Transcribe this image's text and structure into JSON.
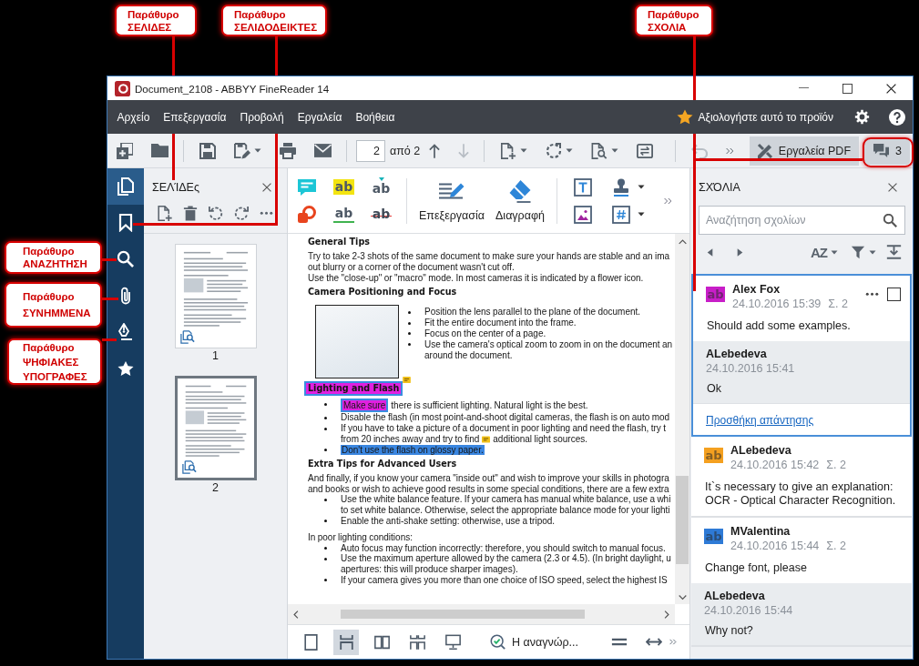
{
  "window": {
    "title": "Document_2108 - ABBYY FineReader 14"
  },
  "menu": {
    "items": [
      "Αρχείο",
      "Επεξεργασία",
      "Προβολή",
      "Εργαλεία",
      "Βοήθεια"
    ],
    "rate_label": "Αξιολογήστε αυτό το προϊόν"
  },
  "toolbar": {
    "groups": [
      [
        {
          "kind": "new-document",
          "dropdown": false,
          "disabled": false
        },
        {
          "kind": "open",
          "dropdown": false,
          "disabled": false
        }
      ],
      [
        {
          "kind": "save",
          "dropdown": false,
          "disabled": false
        },
        {
          "kind": "save-as",
          "dropdown": true,
          "disabled": false
        },
        {
          "kind": "print",
          "dropdown": false,
          "disabled": false
        },
        {
          "kind": "email",
          "dropdown": false,
          "disabled": false
        }
      ],
      [
        {
          "kind": "page-field",
          "value": "2",
          "suffix": "από 2"
        },
        {
          "kind": "previous-page",
          "dropdown": false,
          "disabled": false
        },
        {
          "kind": "next-page",
          "dropdown": false,
          "disabled": true
        }
      ],
      [
        {
          "kind": "add-page",
          "dropdown": true,
          "disabled": false
        },
        {
          "kind": "rotate",
          "dropdown": true,
          "disabled": false
        },
        {
          "kind": "recognize",
          "dropdown": true,
          "disabled": false
        },
        {
          "kind": "compare",
          "dropdown": false,
          "disabled": false
        }
      ],
      [
        {
          "kind": "undo",
          "dropdown": false,
          "disabled": true
        },
        {
          "kind": "more",
          "dropdown": false,
          "disabled": false
        }
      ]
    ],
    "pdf_tools": {
      "label": "Εργαλεία PDF",
      "selected": true
    },
    "comments_button": {
      "count": "3",
      "selected": true
    }
  },
  "sidebar": {
    "items": [
      {
        "kind": "pages",
        "selected": true
      },
      {
        "kind": "bookmarks",
        "selected": false
      },
      {
        "kind": "search",
        "selected": false
      },
      {
        "kind": "attachments",
        "selected": false
      },
      {
        "kind": "signatures",
        "selected": false
      },
      {
        "kind": "favorites",
        "selected": false
      }
    ]
  },
  "pages_panel": {
    "title": "ΣΕΛΊΔΕς",
    "tools": [
      {
        "kind": "add-page"
      },
      {
        "kind": "delete"
      },
      {
        "kind": "rotate-left"
      },
      {
        "kind": "rotate-right"
      },
      {
        "kind": "more"
      }
    ],
    "pages": [
      {
        "label": "1",
        "selected": false
      },
      {
        "label": "2",
        "selected": true
      }
    ]
  },
  "annotation_toolbar": {
    "markup_tools": [
      {
        "kind": "note"
      },
      {
        "kind": "highlight",
        "glyph": "ab"
      },
      {
        "kind": "insert",
        "glyph": "ab"
      },
      {
        "kind": "shape"
      },
      {
        "kind": "underline",
        "glyph": "ab"
      },
      {
        "kind": "strikethrough",
        "glyph": "ab"
      }
    ],
    "big_tools": [
      {
        "kind": "edit",
        "label": "Επεξεργασία"
      },
      {
        "kind": "erase",
        "label": "Διαγραφή"
      }
    ],
    "insert_tools": [
      {
        "kind": "text-box",
        "dropdown": false
      },
      {
        "kind": "stamp",
        "dropdown": true
      },
      {
        "kind": "image",
        "dropdown": false
      },
      {
        "kind": "page-number",
        "dropdown": true
      }
    ]
  },
  "document": {
    "blocks": [
      {
        "kind": "heading",
        "text": "General Tips"
      },
      {
        "kind": "para",
        "lines": [
          "Try to take 2-3 shots of the same document to make sure your hands are stable and an ima",
          "out blurry or a corner of the document wasn't cut off."
        ]
      },
      {
        "kind": "para",
        "lines": [
          "Use the \"close-up\" or \"macro\" mode. In most cameras it is indicated by a flower icon."
        ]
      },
      {
        "kind": "heading",
        "text": "Camera Positioning and Focus"
      },
      {
        "kind": "figure",
        "bullets": [
          {
            "lines": [
              "Position the lens parallel to the plane of the document."
            ]
          },
          {
            "lines": [
              "Fit the entire document into the frame."
            ]
          },
          {
            "lines": [
              "Focus on the center of a page."
            ]
          },
          {
            "lines": [
              "Use the camera's optical zoom to zoom in on the document an",
              "around the document."
            ]
          }
        ]
      },
      {
        "kind": "heading",
        "text": "Lighting and Flash",
        "color": "#e020e0",
        "selected": true,
        "comment_marker": true
      },
      {
        "kind": "bullet",
        "lines": [
          [
            {
              "text": "Make sure",
              "color": "#e020e0",
              "selected": true
            },
            {
              "text": "there is sufficient lighting. Natural light is the best."
            }
          ]
        ]
      },
      {
        "kind": "bullet",
        "lines": [
          "Disable the flash (in most point-and-shoot digital cameras, the flash is on auto mod"
        ]
      },
      {
        "kind": "bullet",
        "lines": [
          "If you have to take a picture of a document in poor lighting and need the flash, try t",
          [
            {
              "text": "from 20 inches away and try to find"
            },
            {
              "text": "additional light sources.",
              "comment_marker": true
            }
          ]
        ]
      },
      {
        "kind": "bullet",
        "lines": [
          [
            {
              "text": "Don't use the flash on glossy paper.",
              "color": "#3a86e0",
              "selected": false
            }
          ]
        ]
      },
      {
        "kind": "heading",
        "text": "Extra Tips for Advanced Users"
      },
      {
        "kind": "para",
        "lines": [
          "And finally, if you know your camera \"inside out\" and wish to improve your skills in photogra",
          "and books or wish to achieve good results in some special conditions, there are a few extra"
        ]
      },
      {
        "kind": "bullet",
        "lines": [
          "Use the white balance feature. If your camera has manual white balance, use a whi",
          "to set white balance. Otherwise, select the appropriate balance mode for your lighti"
        ]
      },
      {
        "kind": "bullet",
        "lines": [
          "Enable the anti-shake setting: otherwise, use a tripod."
        ]
      },
      {
        "kind": "para",
        "lines": [
          "In poor lighting conditions:"
        ]
      },
      {
        "kind": "bullet",
        "lines": [
          "Auto focus may function incorrectly: therefore, you should switch to manual focus."
        ]
      },
      {
        "kind": "bullet",
        "lines": [
          "Use the maximum aperture allowed by the camera (2.3 or 4.5). (In bright daylight, u",
          "apertures: this will produce sharper images)."
        ]
      },
      {
        "kind": "bullet",
        "lines": [
          "If your camera gives you more than one choice of ISO speed, select the highest IS"
        ]
      }
    ]
  },
  "view_bar": {
    "modes": [
      {
        "kind": "single",
        "selected": false
      },
      {
        "kind": "continuous",
        "selected": true
      },
      {
        "kind": "two-page",
        "selected": false
      },
      {
        "kind": "two-page-continuous",
        "selected": false
      },
      {
        "kind": "presentation",
        "selected": false
      }
    ],
    "status": "Η αναγνώρ..."
  },
  "comments": {
    "title": "ΣΧΌΛΙΑ",
    "search": {
      "placeholder": "Αναζήτηση σχολίων"
    },
    "sort_label": "AZ",
    "threads": [
      {
        "selected": true,
        "color": "#c81ec8",
        "glyph": "ab",
        "author": "Alex Fox",
        "time": "24.10.2016 15:39",
        "page": "Σ. 2",
        "checked": false,
        "text": "Should add some examples.",
        "replies": [
          {
            "author": "ALebedeva",
            "time": "24.10.2016 15:41",
            "text": "Ok"
          }
        ],
        "reply_link": "Προσθήκη απάντησης"
      },
      {
        "selected": false,
        "color": "#f4a020",
        "glyph": "ab",
        "author": "ALebedeva",
        "time": "24.10.2016 15:42",
        "page": "Σ. 2",
        "text": "It`s necessary to give an explanation: OCR - Optical Character Recognition."
      },
      {
        "selected": false,
        "color": "#2e7ad6",
        "glyph": "ab",
        "author": "MValentina",
        "time": "24.10.2016 15:44",
        "page": "Σ. 2",
        "text": "Change font, please",
        "replies": [
          {
            "author": "ALebedeva",
            "time": "24.10.2016 15:44",
            "text": "Why not?"
          }
        ]
      }
    ]
  },
  "callouts": [
    {
      "lines": [
        "Παράθυρο",
        "ΣΕΛΙΔΕΣ"
      ]
    },
    {
      "lines": [
        "Παράθυρο",
        "ΣΕΛΙΔΟΔΕΙΚΤΕΣ"
      ]
    },
    {
      "lines": [
        "Παράθυρο",
        "ΣΧΟΛΙΑ"
      ]
    },
    {
      "lines": [
        "Παράθυρο",
        "ΑΝΑΖΗΤΗΣΗ"
      ]
    },
    {
      "lines": [
        "Παράθυρο",
        "ΣΥΝΗΜΜΕΝΑ"
      ]
    },
    {
      "lines": [
        "Παράθυρο",
        "ΨΗΦΙΑΚΕΣ",
        "ΥΠΟΓΡΑΦΕΣ"
      ]
    }
  ]
}
